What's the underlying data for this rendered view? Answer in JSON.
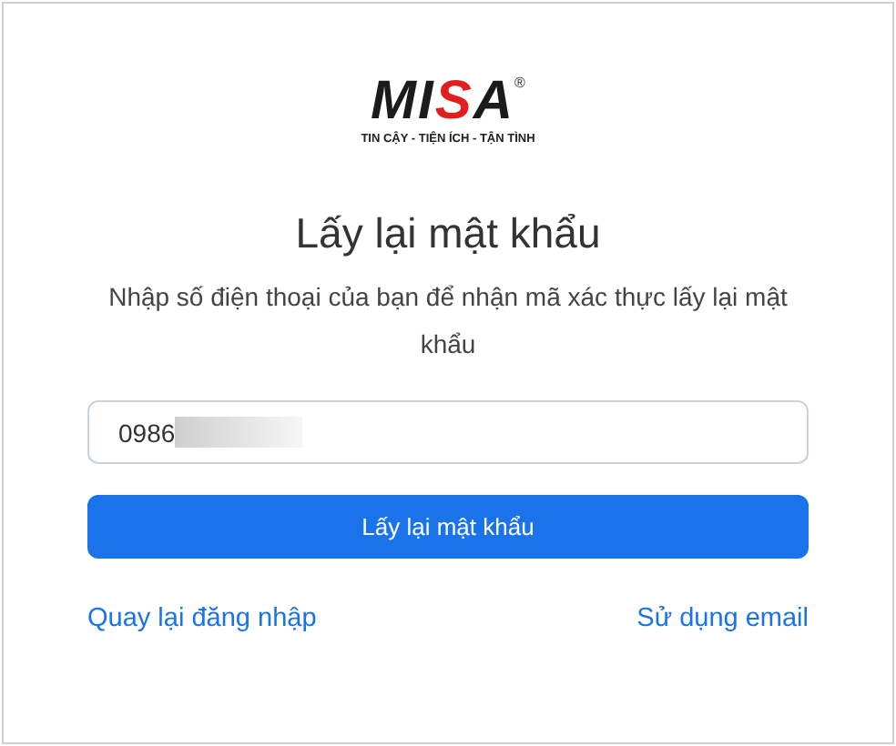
{
  "logo": {
    "parts": [
      {
        "text": "MI",
        "kind": "plain"
      },
      {
        "text": "S",
        "kind": "accent"
      },
      {
        "text": "A",
        "kind": "plain"
      }
    ],
    "mark": "®",
    "tagline": "TIN CẬY - TIỆN ÍCH - TẬN TÌNH"
  },
  "title": "Lấy lại mật khẩu",
  "subtitle": "Nhập số điện thoại của bạn để nhận mã xác thực lấy lại mật khẩu",
  "phone_field": {
    "value": "0986",
    "redacted": true
  },
  "submit_button": "Lấy lại mật khẩu",
  "links": [
    "Quay lại đăng nhập",
    "Sử dụng email"
  ]
}
